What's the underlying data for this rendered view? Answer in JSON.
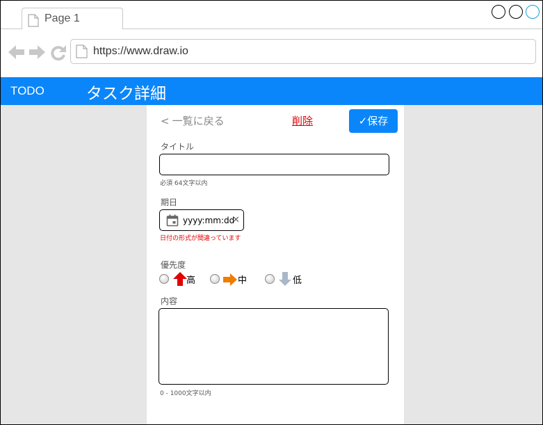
{
  "browser": {
    "tab_label": "Page 1",
    "url": "https://www.draw.io"
  },
  "app": {
    "logo": "TODO",
    "page_title": "タスク詳細"
  },
  "toolbar": {
    "back_label": "一覧に戻る",
    "delete_label": "削除",
    "save_label": "✓保存"
  },
  "form": {
    "title": {
      "label": "タイトル",
      "value": "",
      "hint": "必須 64文字以内"
    },
    "due_date": {
      "label": "期日",
      "placeholder": "yyyy:mm:dd",
      "error": "日付の形式が間違っています"
    },
    "priority": {
      "label": "優先度",
      "options": [
        {
          "label": "高",
          "icon": "arrow-up-icon",
          "color": "#e00000"
        },
        {
          "label": "中",
          "icon": "arrow-right-icon",
          "color": "#f07c00"
        },
        {
          "label": "低",
          "icon": "arrow-down-icon",
          "color": "#a8b8c8"
        }
      ]
    },
    "content": {
      "label": "内容",
      "value": "",
      "hint": "0 - 1000文字以内"
    }
  },
  "colors": {
    "accent": "#0a86fa",
    "error": "#e00000"
  }
}
